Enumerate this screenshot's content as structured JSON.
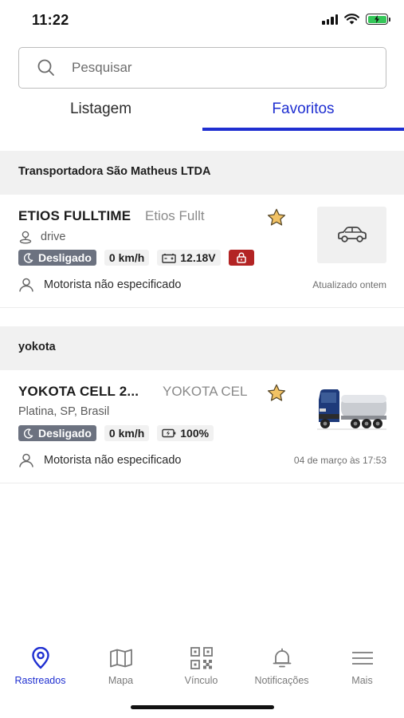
{
  "status_bar": {
    "time": "11:22"
  },
  "search": {
    "placeholder": "Pesquisar",
    "value": ""
  },
  "tabs": [
    {
      "label": "Listagem",
      "active": false
    },
    {
      "label": "Favoritos",
      "active": true
    }
  ],
  "groups": [
    {
      "name": "Transportadora São Matheus LTDA",
      "vehicle": {
        "title": "ETIOS FULLTIME",
        "subtitle": "Etios Fullt",
        "location": "drive",
        "status": "Desligado",
        "speed": "0 km/h",
        "power": "12.18V",
        "locked": true,
        "favorite": true,
        "driver": "Motorista não especificado",
        "updated": "Atualizado ontem",
        "thumbnail": "car-icon"
      }
    },
    {
      "name": "yokota",
      "vehicle": {
        "title": "YOKOTA CELL 2...",
        "subtitle": "YOKOTA CEL",
        "location": "Platina, SP, Brasil",
        "status": "Desligado",
        "speed": "0 km/h",
        "battery": "100%",
        "favorite": true,
        "driver": "Motorista não especificado",
        "updated": "04 de março às 17:53",
        "thumbnail": "truck-photo"
      }
    }
  ],
  "bottom_nav": [
    {
      "label": "Rastreados",
      "icon": "location-pin-icon",
      "active": true
    },
    {
      "label": "Mapa",
      "icon": "map-icon",
      "active": false
    },
    {
      "label": "Vínculo",
      "icon": "qr-code-icon",
      "active": false
    },
    {
      "label": "Notificações",
      "icon": "bell-icon",
      "active": false
    },
    {
      "label": "Mais",
      "icon": "menu-icon",
      "active": false
    }
  ],
  "colors": {
    "accent": "#1f2fd1",
    "status_badge": "#6c7280",
    "lock_badge": "#b32424",
    "star": "#f2c264",
    "section_bg": "#f1f1f1"
  }
}
